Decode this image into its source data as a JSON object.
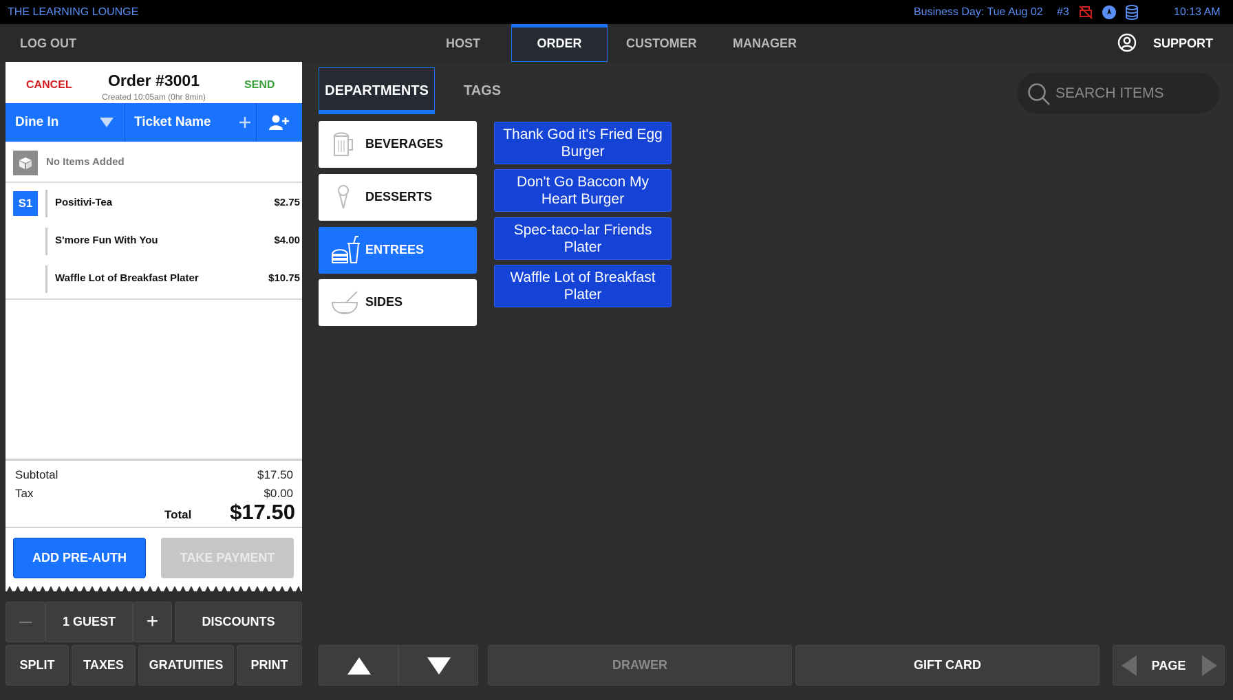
{
  "status_bar": {
    "venue": "THE LEARNING LOUNGE",
    "business_day": "Business Day: Tue Aug 02",
    "terminal": "#3",
    "time": "10:13 AM",
    "icons": [
      "printer-error-icon",
      "location-icon",
      "database-icon"
    ],
    "accent_color": "#5b8ef5"
  },
  "nav": {
    "logout": "LOG OUT",
    "tabs": [
      "HOST",
      "ORDER",
      "CUSTOMER",
      "MANAGER"
    ],
    "active_tab": "ORDER",
    "support": "SUPPORT"
  },
  "ticket": {
    "cancel": "CANCEL",
    "order_title": "Order #3001",
    "created": "Created 10:05am (0hr 8min)",
    "send": "SEND",
    "order_type": "Dine In",
    "ticket_name": "Ticket Name",
    "no_items": "No Items Added",
    "seat": "S1",
    "items": [
      {
        "name": "Positivi-Tea",
        "price": "$2.75"
      },
      {
        "name": "S'more Fun With You",
        "price": "$4.00"
      },
      {
        "name": "Waffle Lot of Breakfast Plater",
        "price": "$10.75"
      }
    ],
    "subtotal_label": "Subtotal",
    "subtotal": "$17.50",
    "tax_label": "Tax",
    "tax": "$0.00",
    "total_label": "Total",
    "total": "$17.50",
    "add_preauth": "ADD PRE-AUTH",
    "take_payment": "TAKE PAYMENT"
  },
  "guest_bar": {
    "minus": "—",
    "guests": "1 GUEST",
    "plus": "+",
    "discounts": "DISCOUNTS"
  },
  "action_bar": {
    "split": "SPLIT",
    "taxes": "TAXES",
    "gratuities": "GRATUITIES",
    "print": "PRINT"
  },
  "menu": {
    "tabs": [
      "DEPARTMENTS",
      "TAGS"
    ],
    "active_tab": "DEPARTMENTS",
    "search_placeholder": "SEARCH ITEMS",
    "departments": [
      {
        "label": "BEVERAGES",
        "icon": "beer-mug-icon"
      },
      {
        "label": "DESSERTS",
        "icon": "ice-cream-icon"
      },
      {
        "label": "ENTREES",
        "icon": "burger-drink-icon"
      },
      {
        "label": "SIDES",
        "icon": "bowl-icon"
      }
    ],
    "selected_department": "ENTREES",
    "items": [
      "Thank God it's Fried Egg Burger",
      "Don't Go Baccon My Heart Burger",
      "Spec-taco-lar Friends Plater",
      "Waffle Lot of Breakfast Plater"
    ]
  },
  "bottom_bar": {
    "drawer": "DRAWER",
    "gift_card": "GIFT CARD",
    "page": "PAGE"
  }
}
